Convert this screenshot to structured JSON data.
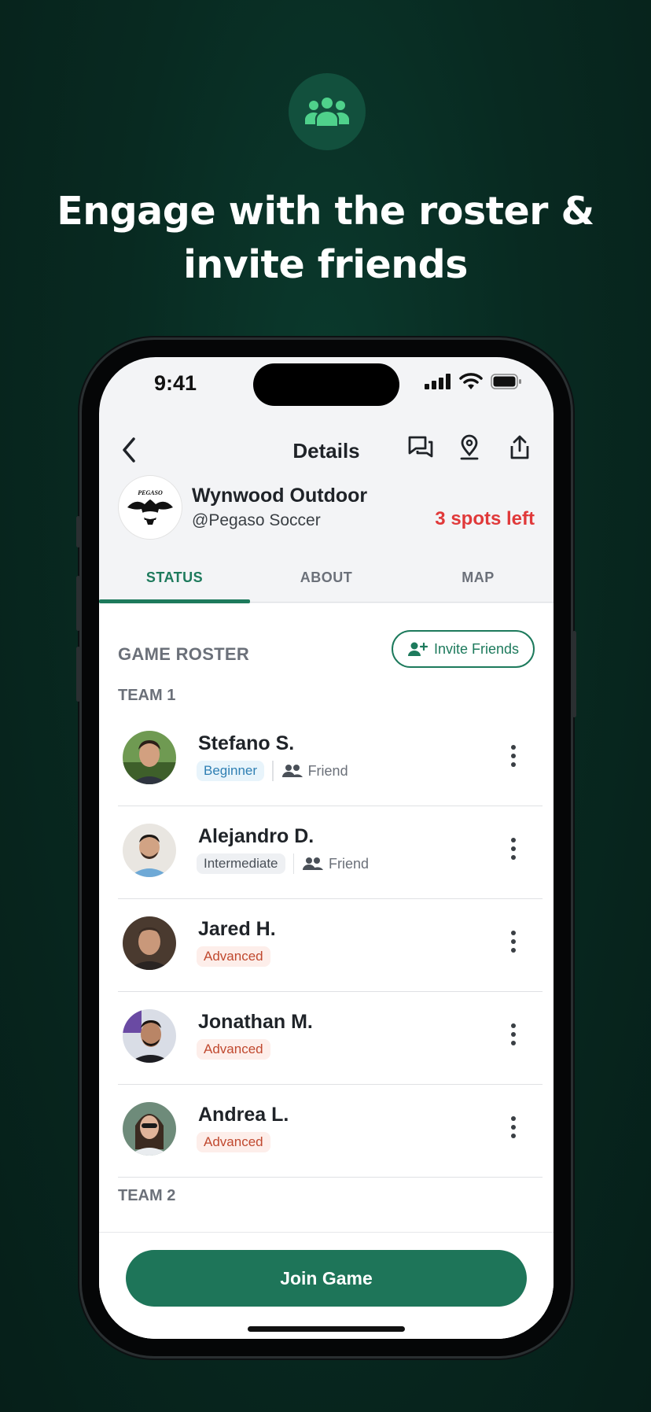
{
  "headline": {
    "line1": "Engage with the roster &",
    "line2": "invite friends"
  },
  "hero_icon": "group-icon",
  "status_bar": {
    "time": "9:41"
  },
  "nav": {
    "title": "Details"
  },
  "club": {
    "name": "Wynwood Outdoor",
    "handle": "@Pegaso Soccer",
    "spots": "3 spots left",
    "logo_text": "PEGASO"
  },
  "tabs": [
    {
      "label": "STATUS"
    },
    {
      "label": "ABOUT"
    },
    {
      "label": "MAP"
    }
  ],
  "roster": {
    "title": "GAME ROSTER",
    "invite_label": "Invite Friends",
    "team1_label": "TEAM 1",
    "team2_label": "TEAM 2",
    "players": [
      {
        "name": "Stefano S.",
        "level": "Beginner",
        "friend": "Friend"
      },
      {
        "name": "Alejandro D.",
        "level": "Intermediate",
        "friend": "Friend"
      },
      {
        "name": "Jared H.",
        "level": "Advanced"
      },
      {
        "name": "Jonathan M.",
        "level": "Advanced"
      },
      {
        "name": "Andrea L.",
        "level": "Advanced"
      }
    ]
  },
  "join_label": "Join Game",
  "colors": {
    "accent": "#1d7a5c",
    "background": "#082a21",
    "spots": "#e0393a"
  }
}
